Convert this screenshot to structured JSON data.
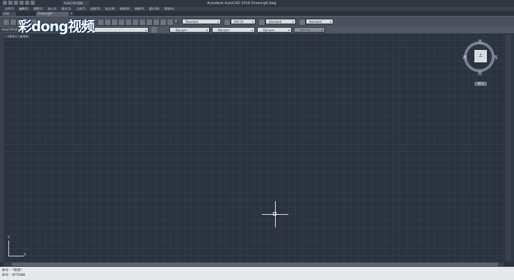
{
  "window": {
    "title": "Autodesk AutoCAD 2018    Drawing6.dwg",
    "app_tab": "AutoCAD 经典",
    "search_placeholder": ""
  },
  "menubar": [
    "文件(F)",
    "编辑(E)",
    "视图(V)",
    "插入(I)",
    "格式(O)",
    "工具(T)",
    "绘图(D)",
    "标注(N)",
    "修改(M)",
    "参数(P)",
    "窗口(W)",
    "帮助(H)"
  ],
  "file_tabs": [
    {
      "label": "开始",
      "active": false
    },
    {
      "label": "Drawing6*",
      "active": true
    },
    {
      "label": "+",
      "active": false
    }
  ],
  "styles": {
    "text_style": "Standard",
    "dim_style": "ISO-25",
    "table_style": "Standard",
    "multileader_style": "Standard"
  },
  "properties": {
    "workspace": "AutoCAD 经典",
    "color": "ByLayer",
    "linetype": "ByLayer",
    "lineweight": "ByLayer",
    "plotstyle": "ByColor"
  },
  "viewport": {
    "label": "[-][俯视][二维线框]"
  },
  "viewcube": {
    "north": "北",
    "south": "南",
    "east": "东",
    "west": "西",
    "face": "上",
    "wcs": "WCS"
  },
  "ucs": {
    "x": "X",
    "y": "Y"
  },
  "command": {
    "history": "命令: *取消*",
    "current": "命令: OPTIONS"
  },
  "watermark": "彩dong视频",
  "colors": {
    "canvas": "#2b3341",
    "grid": "#323b4a",
    "chrome": "#4a515d"
  }
}
